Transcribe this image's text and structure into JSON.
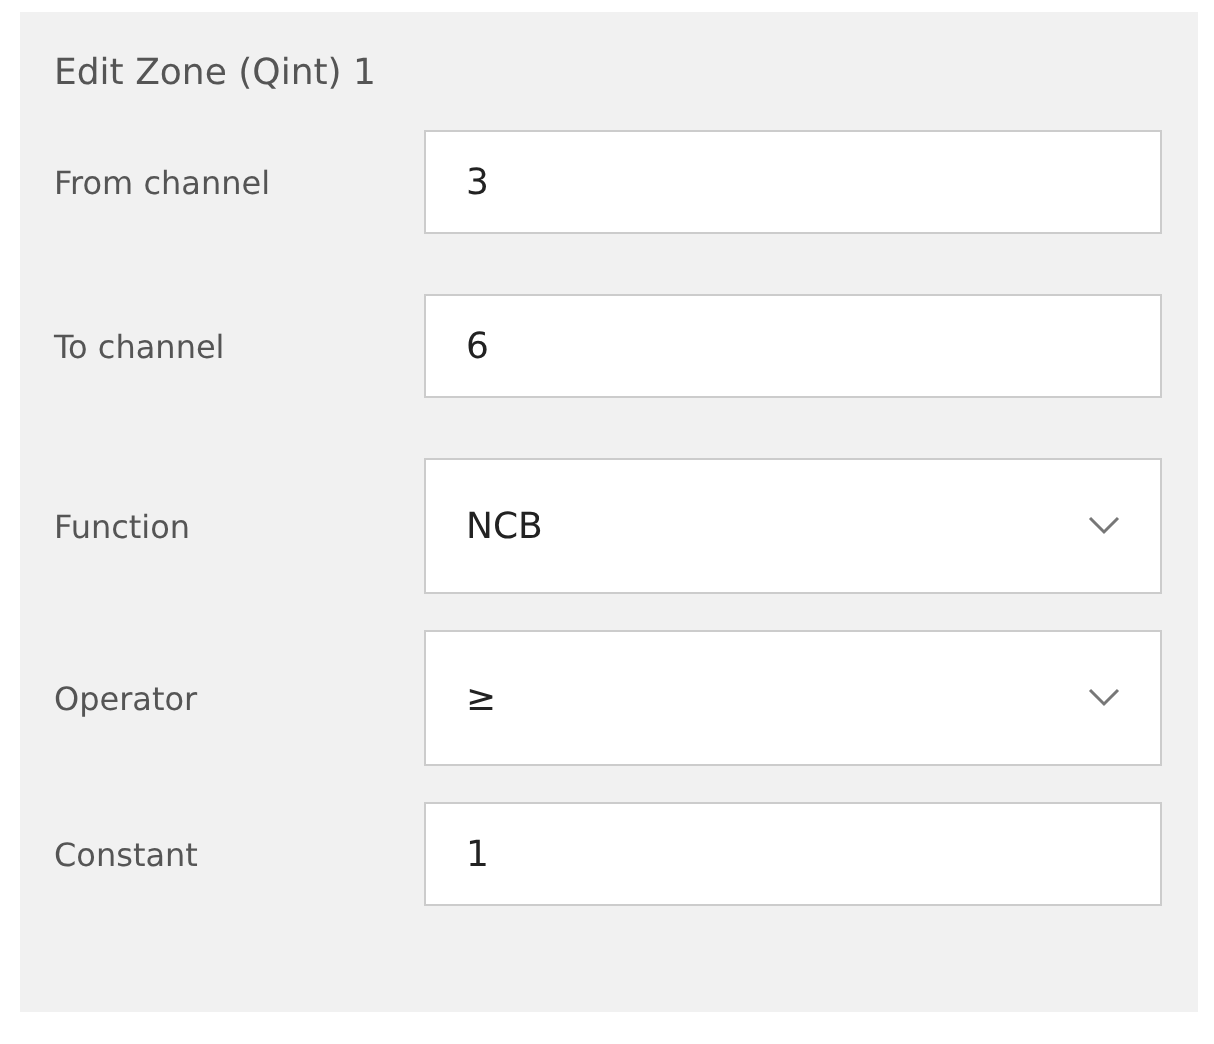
{
  "panel": {
    "title": "Edit Zone (Qint) 1"
  },
  "fields": [
    {
      "label": "From channel",
      "kind": "text",
      "value": "3"
    },
    {
      "label": "To channel",
      "kind": "text",
      "value": "6"
    },
    {
      "label": "Function",
      "kind": "select",
      "value": "NCB"
    },
    {
      "label": "Operator",
      "kind": "select",
      "value": "≥"
    },
    {
      "label": "Constant",
      "kind": "text",
      "value": "1"
    }
  ]
}
